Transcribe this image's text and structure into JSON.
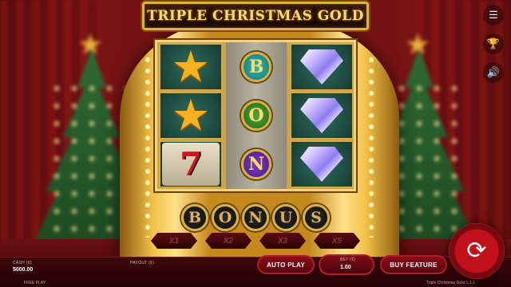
{
  "game": {
    "title": "TRIPLE CHRISTMAS GOLD"
  },
  "reels": [
    [
      "star",
      "star",
      "seven"
    ],
    [
      "B",
      "O",
      "N"
    ],
    [
      "diamond",
      "diamond",
      "diamond"
    ]
  ],
  "bonus_letters": [
    "B",
    "O",
    "N",
    "U",
    "S"
  ],
  "multipliers": [
    "X1",
    "X2",
    "X3",
    "X5"
  ],
  "side_icons": [
    "menu-icon",
    "trophy-icon",
    "sound-icon"
  ],
  "bottom_bar": {
    "cash_label": "CASH (€)",
    "cash_value": "5000.00",
    "payout_label": "PAYOUT (€)",
    "auto_play_label": "AUTO PLAY",
    "bet_label": "BET (€)",
    "bet_value": "1.00",
    "buy_feature_label": "BUY FEATURE",
    "free_play_label": "FREE PLAY",
    "version_label": "Triple Christmas Gold  1.1.1"
  },
  "colors": {
    "gold": "#f2c24a",
    "button_red": "#8a0e18",
    "background": "#3a0608"
  }
}
